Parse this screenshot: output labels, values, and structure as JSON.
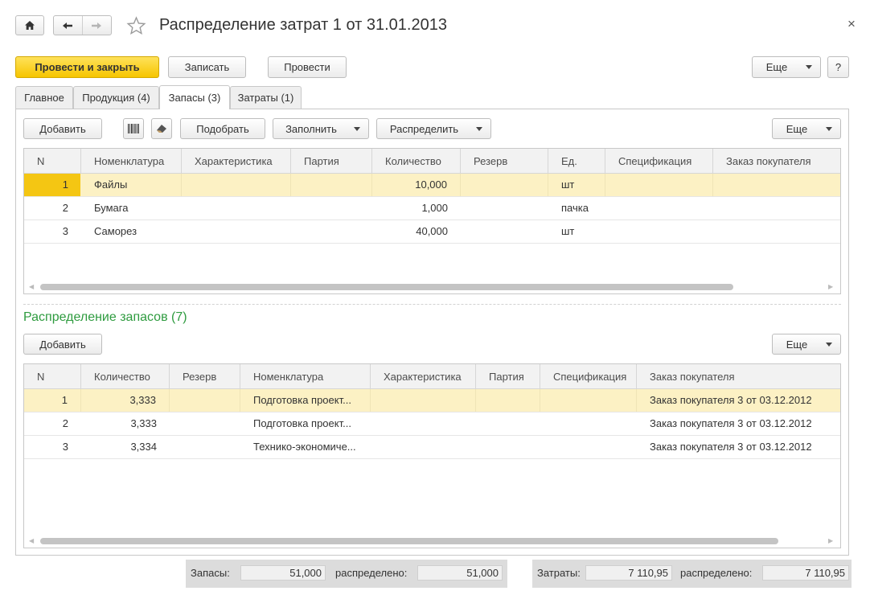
{
  "window": {
    "title": "Распределение затрат 1 от 31.01.2013",
    "close_glyph": "×"
  },
  "toolbar": {
    "post_close": "Провести и закрыть",
    "save": "Записать",
    "post": "Провести",
    "more": "Еще",
    "help": "?"
  },
  "tabs": [
    {
      "label": "Главное"
    },
    {
      "label": "Продукция (4)"
    },
    {
      "label": "Запасы (3)"
    },
    {
      "label": "Затраты (1)"
    }
  ],
  "inventory_toolbar": {
    "add": "Добавить",
    "select": "Подобрать",
    "fill": "Заполнить",
    "distribute": "Распределить",
    "more": "Еще"
  },
  "inventory_table": {
    "headers": [
      "N",
      "Номенклатура",
      "Характеристика",
      "Партия",
      "Количество",
      "Резерв",
      "Ед.",
      "Спецификация",
      "Заказ покупателя"
    ],
    "rows": [
      {
        "n": "1",
        "item": "Файлы",
        "qty": "10,000",
        "unit": "шт"
      },
      {
        "n": "2",
        "item": "Бумага",
        "qty": "1,000",
        "unit": "пачка"
      },
      {
        "n": "3",
        "item": "Саморез",
        "qty": "40,000",
        "unit": "шт"
      }
    ]
  },
  "distribution": {
    "title": "Распределение запасов (7)",
    "add": "Добавить",
    "more": "Еще",
    "headers": [
      "N",
      "Количество",
      "Резерв",
      "Номенклатура",
      "Характеристика",
      "Партия",
      "Спецификация",
      "Заказ покупателя"
    ],
    "rows": [
      {
        "n": "1",
        "qty": "3,333",
        "item": "Подготовка проект...",
        "order": "Заказ покупателя 3 от 03.12.2012"
      },
      {
        "n": "2",
        "qty": "3,333",
        "item": "Подготовка проект...",
        "order": "Заказ покупателя 3 от 03.12.2012"
      },
      {
        "n": "3",
        "qty": "3,334",
        "item": "Технико-экономиче...",
        "order": "Заказ покупателя 3 от 03.12.2012"
      }
    ]
  },
  "footer": {
    "inventory_label": "Запасы:",
    "inventory_value": "51,000",
    "inventory_dist_label": "распределено:",
    "inventory_dist_value": "51,000",
    "costs_label": "Затраты:",
    "costs_value": "7 110,95",
    "costs_dist_label": "распределено:",
    "costs_dist_value": "7 110,95"
  },
  "colors": {
    "accent_yellow": "#f6c500",
    "selected_row": "#fcf1c4",
    "section_title_green": "#2e9b3f"
  }
}
